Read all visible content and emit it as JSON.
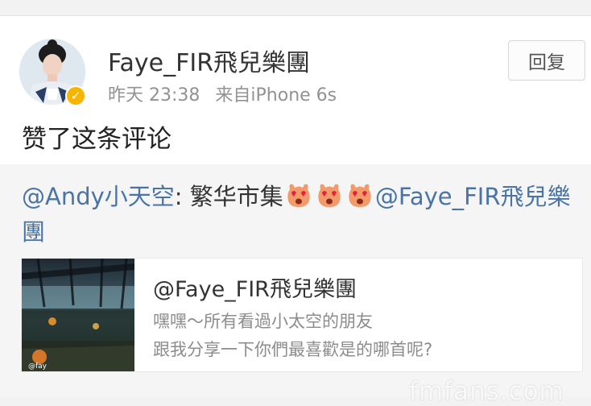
{
  "post": {
    "username": "Faye_FIR飛兒樂團",
    "time": "昨天 23:38",
    "source": "来自iPhone 6s",
    "reply_label": "回复",
    "action_text": "赞了这条评论"
  },
  "comment": {
    "mention_author": "@Andy小天空",
    "separator": ": ",
    "body": "繁华市集",
    "emoji_name": "heart-eyes-emoji",
    "emoji_count": 3,
    "mention_tail": "@Faye_FIR飛兒樂團"
  },
  "repost": {
    "title": "@Faye_FIR飛兒樂團",
    "line1": "嘿嘿～所有看過小太空的朋友",
    "line2": "跟我分享一下你們最喜歡是的哪首呢?",
    "thumb_caption": "@fay"
  },
  "watermark": "fmfans.com",
  "colors": {
    "link": "#4a74a6",
    "verified_badge": "#f7b500",
    "background": "#f2f2f2"
  }
}
